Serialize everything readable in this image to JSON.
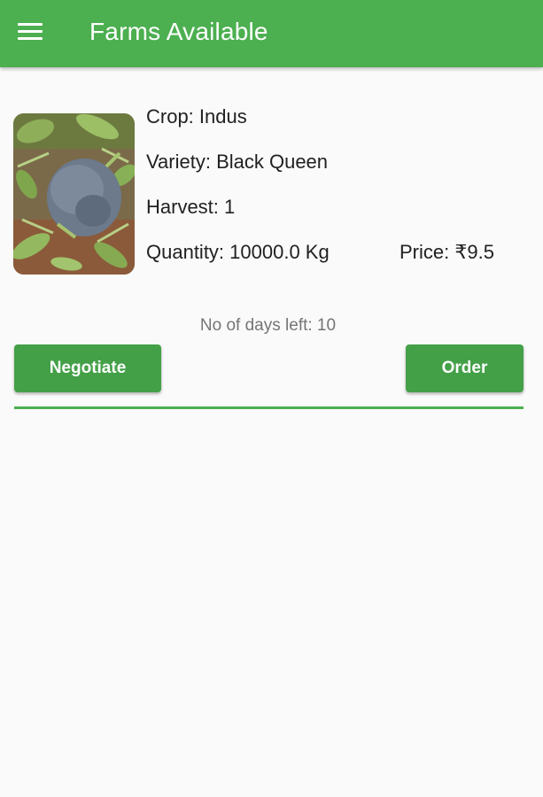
{
  "app_bar": {
    "title": "Farms Available",
    "menu_icon": "hamburger-menu-icon",
    "color": "#4caf50"
  },
  "listing": {
    "image_subject": "crop photo",
    "crop": "Crop: Indus",
    "variety": "Variety: Black Queen",
    "harvest": "Harvest: 1",
    "quantity": "Quantity: 10000.0 Kg",
    "price": "Price: ₹9.5",
    "days_left": "No of days left: 10",
    "negotiate_label": "Negotiate",
    "order_label": "Order",
    "button_color": "#43a047"
  }
}
